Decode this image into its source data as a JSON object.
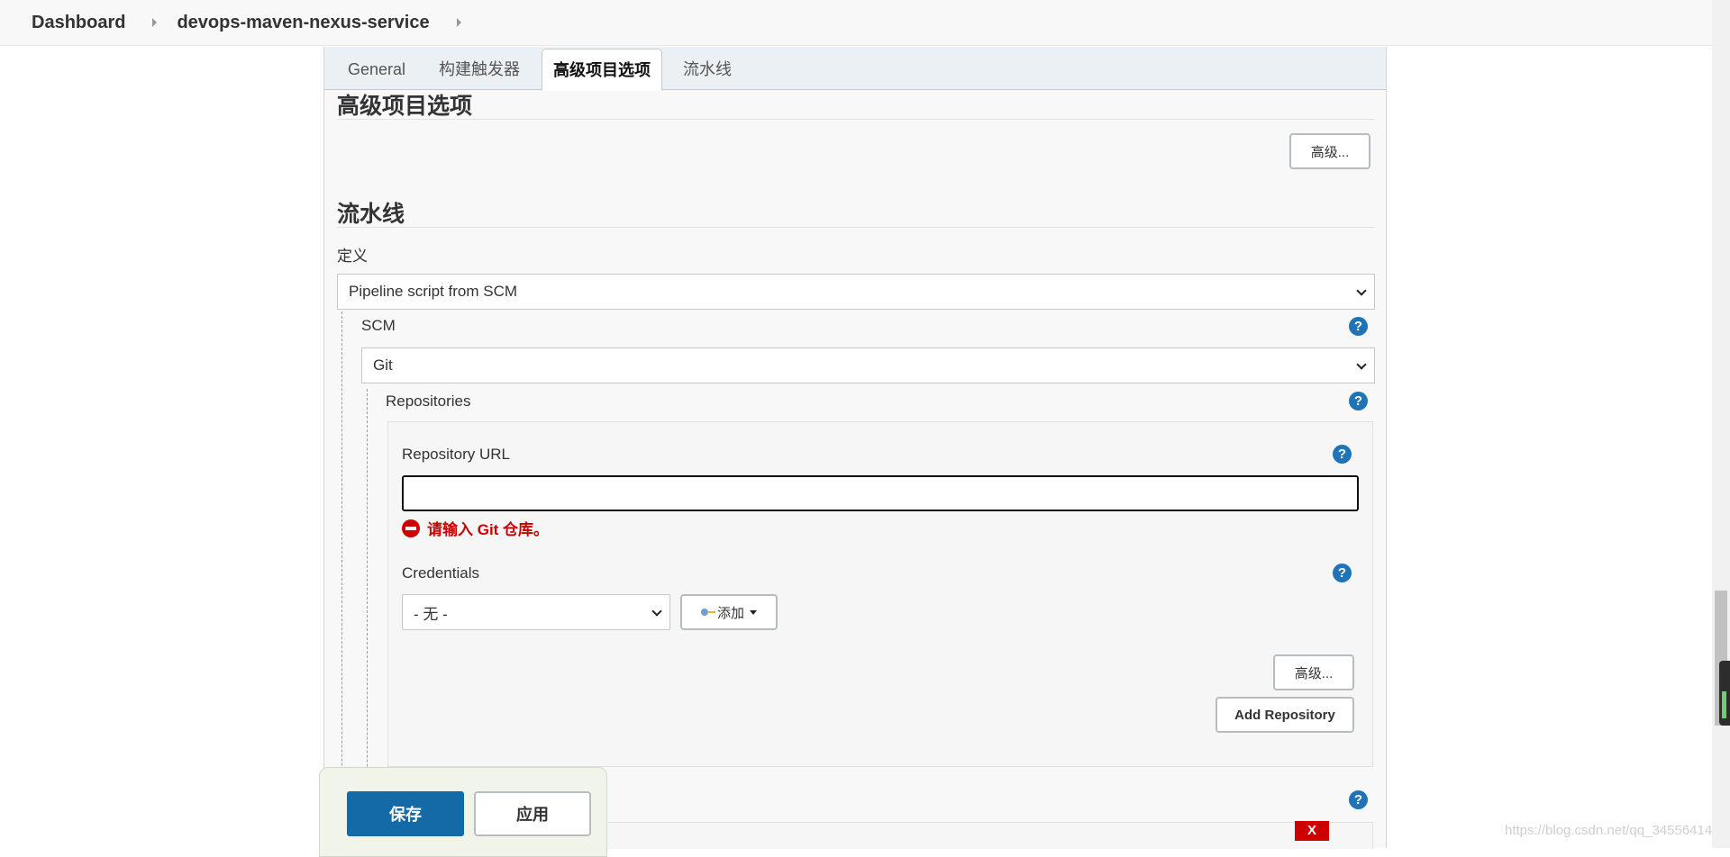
{
  "breadcrumb": {
    "dashboard": "Dashboard",
    "project": "devops-maven-nexus-service"
  },
  "tabs": [
    {
      "label": "General"
    },
    {
      "label": "构建触发器"
    },
    {
      "label": "高级项目选项",
      "active": true
    },
    {
      "label": "流水线"
    }
  ],
  "advanced": {
    "title": "高级项目选项",
    "button": "高级..."
  },
  "pipeline": {
    "title": "流水线",
    "definition_label": "定义",
    "definition_value": "Pipeline script from SCM",
    "scm_label": "SCM",
    "scm_value": "Git",
    "repositories_label": "Repositories",
    "repo_url_label": "Repository URL",
    "repo_url_value": "",
    "error_text": "请输入 Git 仓库。",
    "credentials_label": "Credentials",
    "credentials_value": "- 无 -",
    "add_label": "添加",
    "advanced_button": "高级...",
    "add_repository_button": "Add Repository",
    "delete_label": "X"
  },
  "savebar": {
    "save": "保存",
    "apply": "应用"
  },
  "watermark": "https://blog.csdn.net/qq_34556414",
  "colors": {
    "primary": "#146aa7",
    "help": "#1e74b6",
    "error": "#cc0000"
  },
  "icons": [
    "help-icon",
    "error-icon",
    "key-icon",
    "chevron-down-icon",
    "chevron-right-icon"
  ]
}
